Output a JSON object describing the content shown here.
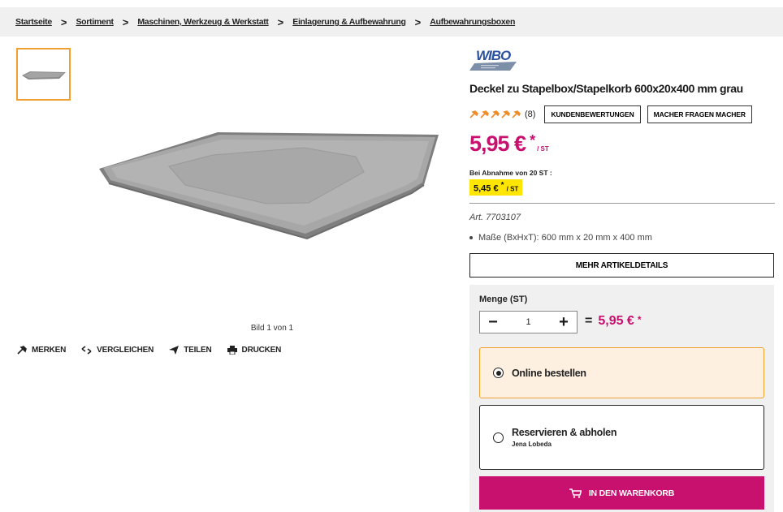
{
  "breadcrumb": {
    "items": [
      "Startseite",
      "Sortiment",
      "Maschinen, Werkzeug & Werkstatt",
      "Einlagerung & Aufbewahrung",
      "Aufbewahrungsboxen"
    ]
  },
  "gallery": {
    "caption": "Bild 1 von 1"
  },
  "actions": {
    "merken": "MERKEN",
    "vergleichen": "VERGLEICHEN",
    "teilen": "TEILEN",
    "drucken": "DRUCKEN"
  },
  "product": {
    "brand_logo_text": "WIBO",
    "title": "Deckel zu Stapelbox/Stapelkorb 600x20x400 mm grau",
    "rating_stars": 5,
    "rating_count": "(8)",
    "reviews_button": "KUNDENBEWERTUNGEN",
    "questions_button": "MACHER FRAGEN MACHER",
    "price": "5,95 €",
    "price_star": "*",
    "price_unit": "/ ST",
    "bulk_label": "Bei Abnahme von 20 ST :",
    "bulk_price": "5,45 €",
    "bulk_star": "*",
    "bulk_unit": "/ ST",
    "article_number": "Art. 7703107",
    "dimensions": "Maße (BxHxT): 600 mm x 20 mm x 400 mm",
    "more_details_button": "MEHR ARTIKELDETAILS"
  },
  "order": {
    "quantity_label": "Menge (ST)",
    "quantity_value": "1",
    "minus": "−",
    "plus": "+",
    "equals": "=",
    "total": "5,95 €",
    "total_star": "*",
    "option_online": "Online bestellen",
    "option_reserve": "Reservieren & abholen",
    "option_reserve_store": "Jena Lobeda",
    "cart_button": "IN DEN WARENKORB"
  },
  "colors": {
    "accent": "#c8106e",
    "highlight": "#ffe600",
    "selection_border": "#f0a030"
  }
}
